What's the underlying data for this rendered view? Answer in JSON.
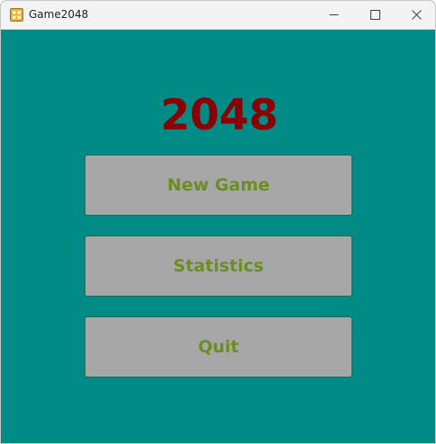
{
  "window": {
    "title": "Game2048",
    "icon": "game2048-app-icon",
    "controls": [
      "minimize-icon",
      "maximize-icon",
      "close-icon"
    ]
  },
  "main": {
    "title": "2048",
    "buttons": {
      "new_game": "New Game",
      "statistics": "Statistics",
      "quit": "Quit"
    }
  },
  "colors": {
    "background": "#008b86",
    "title": "#8b0000",
    "button_face": "#a7a7a7",
    "button_text": "#6b8e23",
    "button_border": "#1e6b4f"
  }
}
